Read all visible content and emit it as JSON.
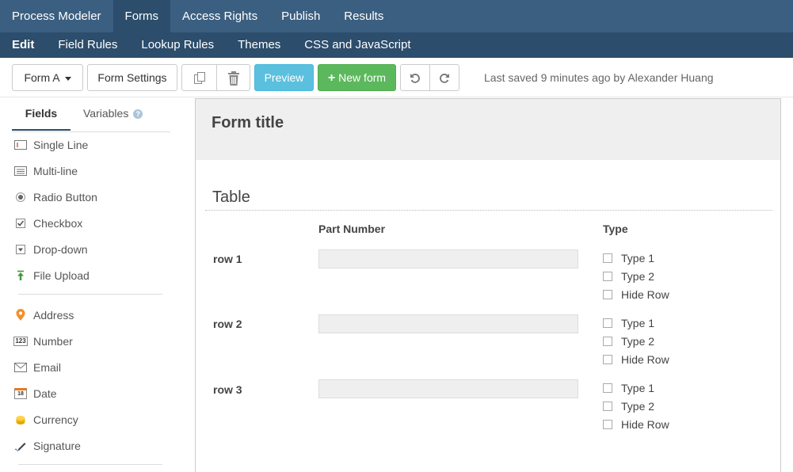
{
  "topnav": [
    "Process Modeler",
    "Forms",
    "Access Rights",
    "Publish",
    "Results"
  ],
  "subnav": [
    "Edit",
    "Field Rules",
    "Lookup Rules",
    "Themes",
    "CSS and JavaScript"
  ],
  "toolbar": {
    "form_select": "Form A",
    "form_settings": "Form Settings",
    "preview": "Preview",
    "new_form": "New form",
    "last_saved": "Last saved 9 minutes ago by Alexander Huang"
  },
  "sidebar": {
    "tabs": {
      "fields": "Fields",
      "variables": "Variables",
      "help_glyph": "?"
    },
    "basic_fields": [
      "Single Line",
      "Multi-line",
      "Radio Button",
      "Checkbox",
      "Drop-down",
      "File Upload"
    ],
    "advanced_fields": [
      "Address",
      "Number",
      "Email",
      "Date",
      "Currency",
      "Signature"
    ],
    "number_icon_text": "123",
    "date_icon_text": "18"
  },
  "form": {
    "title": "Form title",
    "section": "Table",
    "col_part": "Part Number",
    "col_type": "Type",
    "rows": [
      {
        "label": "row 1",
        "options": [
          "Type 1",
          "Type 2",
          "Hide Row"
        ]
      },
      {
        "label": "row 2",
        "options": [
          "Type 1",
          "Type 2",
          "Hide Row"
        ]
      },
      {
        "label": "row 3",
        "options": [
          "Type 1",
          "Type 2",
          "Hide Row"
        ]
      }
    ]
  },
  "colors": {
    "nav_top": "#3b5f80",
    "nav_sub": "#2c4d6b",
    "preview": "#5bc0de",
    "new_form": "#5cb85c",
    "address_icon": "#f0912b",
    "upload_icon": "#3a9a3a",
    "currency_icon": "#f0b400",
    "date_icon": "#e47a24"
  }
}
